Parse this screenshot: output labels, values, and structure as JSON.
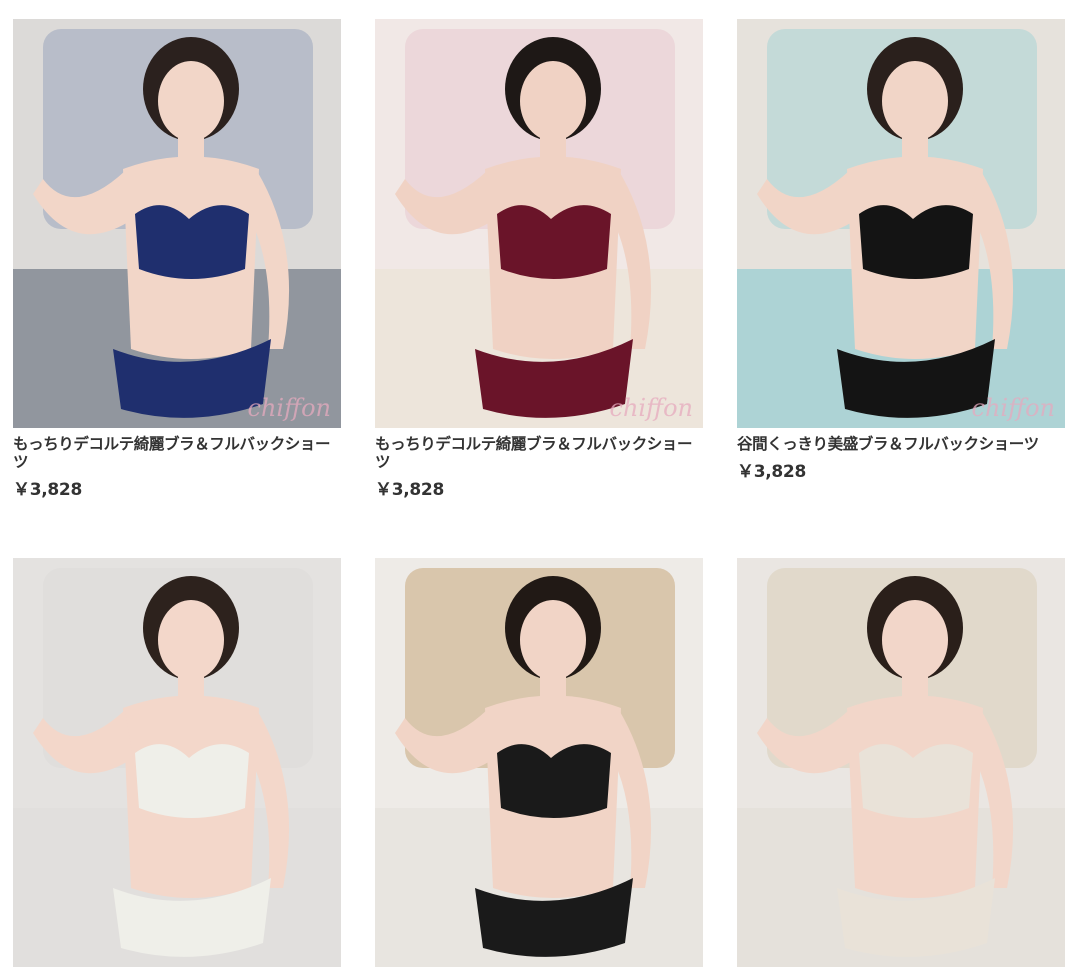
{
  "products": [
    {
      "title": "もっちりデコルテ綺麗ブラ＆フルバックショーツ",
      "price": "￥3,828",
      "watermark": "chiffon",
      "colors": {
        "bg": "#dcdad8",
        "accent": "#9aa6bd",
        "bed": "#7e8590",
        "skin": "#f2d6c8",
        "hair": "#2b211e",
        "lingerie": "#1f2f6e"
      }
    },
    {
      "title": "もっちりデコルテ綺麗ブラ＆フルバックショーツ",
      "price": "￥3,828",
      "watermark": "chiffon",
      "colors": {
        "bg": "#f1e8e6",
        "accent": "#e8c8cf",
        "bed": "#ece4d8",
        "skin": "#f0d2c4",
        "hair": "#1e1816",
        "lingerie": "#6a1429"
      }
    },
    {
      "title": "谷間くっきり美盛ブラ＆フルバックショーツ",
      "price": "￥3,828",
      "watermark": "chiffon",
      "colors": {
        "bg": "#e6e2dc",
        "accent": "#a7d3d6",
        "bed": "#9fcfd3",
        "skin": "#f1d5c7",
        "hair": "#2a201c",
        "lingerie": "#141414"
      }
    },
    {
      "title": "",
      "price": "",
      "watermark": "",
      "colors": {
        "bg": "#e4e2e0",
        "accent": "#dcdad8",
        "bed": "#e0dedc",
        "skin": "#f3d7ca",
        "hair": "#2d221d",
        "lingerie": "#efefe9"
      }
    },
    {
      "title": "",
      "price": "",
      "watermark": "",
      "colors": {
        "bg": "#eeebe7",
        "accent": "#c9a77c",
        "bed": "#e6e3de",
        "skin": "#f1d4c6",
        "hair": "#211915",
        "lingerie": "#1a1a1a"
      }
    },
    {
      "title": "",
      "price": "",
      "watermark": "",
      "colors": {
        "bg": "#eae6e2",
        "accent": "#d9cdb8",
        "bed": "#e4e0da",
        "skin": "#f2d6c9",
        "hair": "#2a1f1a",
        "lingerie": "#e9e2d8"
      }
    }
  ]
}
